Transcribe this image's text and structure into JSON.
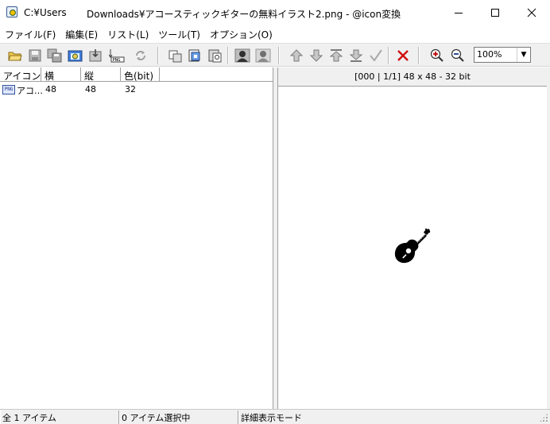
{
  "window": {
    "path": "C:¥Users",
    "title": "Downloads¥アコースティックギターの無料イラスト2.png - @icon変換",
    "minimize_glyph": "—",
    "maximize_glyph": "☐",
    "close_glyph": "✕"
  },
  "menu": [
    {
      "label": "ファイル(F)"
    },
    {
      "label": "編集(E)"
    },
    {
      "label": "リスト(L)"
    },
    {
      "label": "ツール(T)"
    },
    {
      "label": "オプション(O)"
    }
  ],
  "toolbar": {
    "zoom_value": "100%",
    "icons": [
      "open-folder-icon",
      "save-icon",
      "save-all-icon",
      "capture-icon",
      "extract-icon",
      "png-icon",
      "refresh-icon",
      "copy-icon",
      "copy-special-icon",
      "paste-icon",
      "person-dark-icon",
      "person-light-icon",
      "move-up-icon",
      "move-down-icon",
      "move-top-icon",
      "move-bottom-icon",
      "check-icon",
      "delete-icon",
      "zoom-in-icon",
      "zoom-out-icon"
    ]
  },
  "list": {
    "columns": [
      "アイコン…",
      "横",
      "縦",
      "色(bit)"
    ],
    "rows": [
      {
        "icon_badge": "PNG",
        "name": "アコ…",
        "width": "48",
        "height": "48",
        "bits": "32"
      }
    ]
  },
  "preview": {
    "info": "[000 | 1/1] 48 x 48 - 32 bit",
    "image": "acoustic-guitar-icon"
  },
  "status": {
    "total": "全 1 アイテム",
    "selected": "0 アイテム選択中",
    "mode": "詳細表示モード"
  },
  "colors": {
    "toolbar_bg": "#f0f0f0",
    "delete_red": "#d01010",
    "zoom_red": "#c00000"
  }
}
